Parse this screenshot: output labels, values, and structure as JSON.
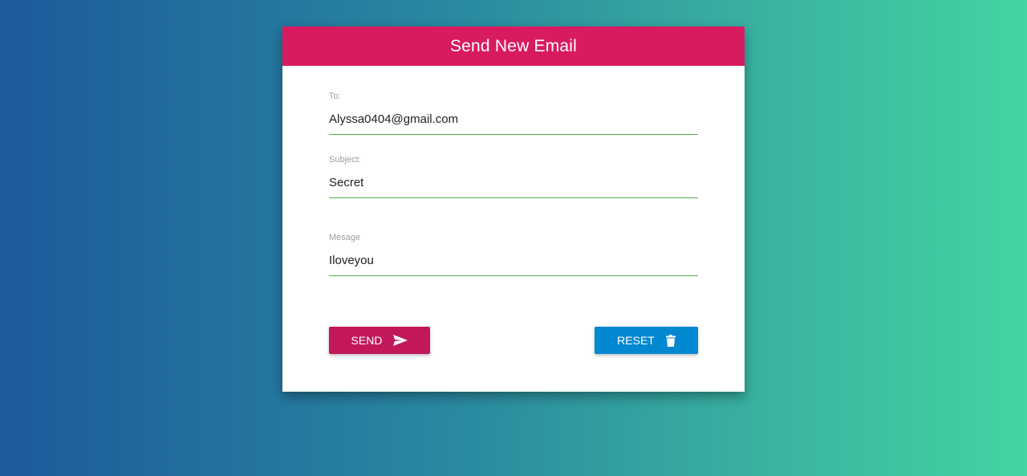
{
  "form": {
    "title": "Send New Email",
    "header_color": "#d81b60",
    "fields": {
      "to": {
        "label": "To:",
        "value": "Alyssa0404@gmail.com"
      },
      "subject": {
        "label": "Subject:",
        "value": "Secret"
      },
      "message": {
        "label": "Mesage",
        "value": "Iloveyou"
      }
    },
    "buttons": {
      "send": {
        "label": "SEND",
        "icon": "send-icon",
        "color": "#c2185b"
      },
      "reset": {
        "label": "RESET",
        "icon": "trash-icon",
        "color": "#0288d1"
      }
    }
  }
}
